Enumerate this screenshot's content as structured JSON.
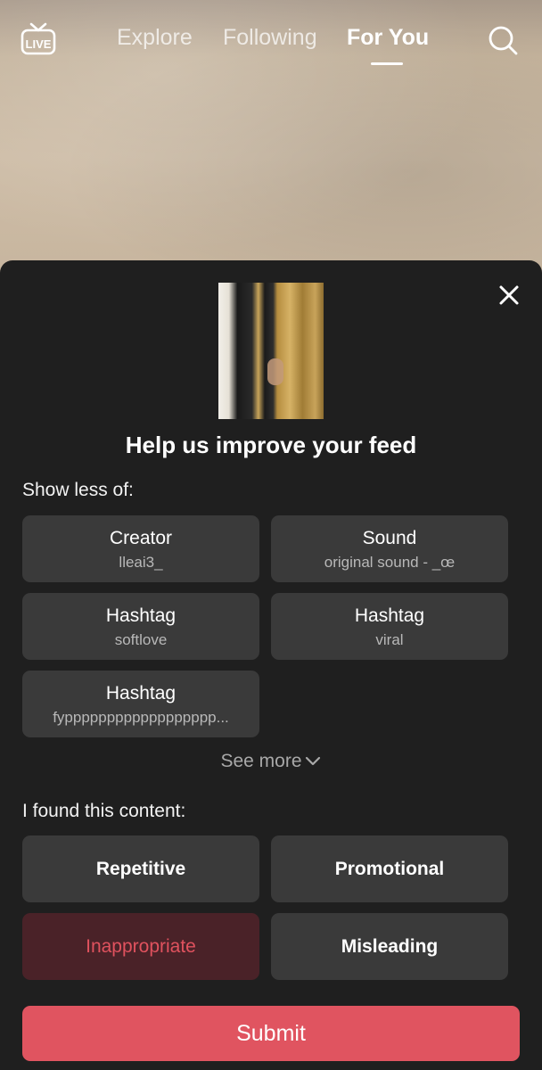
{
  "topnav": {
    "live_label": "LIVE",
    "tabs": [
      {
        "label": "Explore"
      },
      {
        "label": "Following"
      },
      {
        "label": "For You",
        "active": true
      }
    ]
  },
  "sheet": {
    "title": "Help us improve your feed",
    "show_less_label": "Show less of:",
    "show_less_options": [
      {
        "type": "Creator",
        "value": "lleai3_"
      },
      {
        "type": "Sound",
        "value": "original sound - _œ"
      },
      {
        "type": "Hashtag",
        "value": "softlove"
      },
      {
        "type": "Hashtag",
        "value": "viral"
      },
      {
        "type": "Hashtag",
        "value": "fypppppppppppppppppp..."
      }
    ],
    "see_more": "See more",
    "found_label": "I found this content:",
    "reasons": [
      {
        "label": "Repetitive",
        "selected": false
      },
      {
        "label": "Promotional",
        "selected": false
      },
      {
        "label": "Inappropriate",
        "selected": true
      },
      {
        "label": "Misleading",
        "selected": false
      }
    ],
    "submit": "Submit"
  },
  "colors": {
    "sheet_bg": "#1f1f1f",
    "option_bg": "#3a3a3a",
    "accent_red": "#e05460",
    "selected_bg": "#4a2228",
    "selected_text": "#e0525e"
  }
}
